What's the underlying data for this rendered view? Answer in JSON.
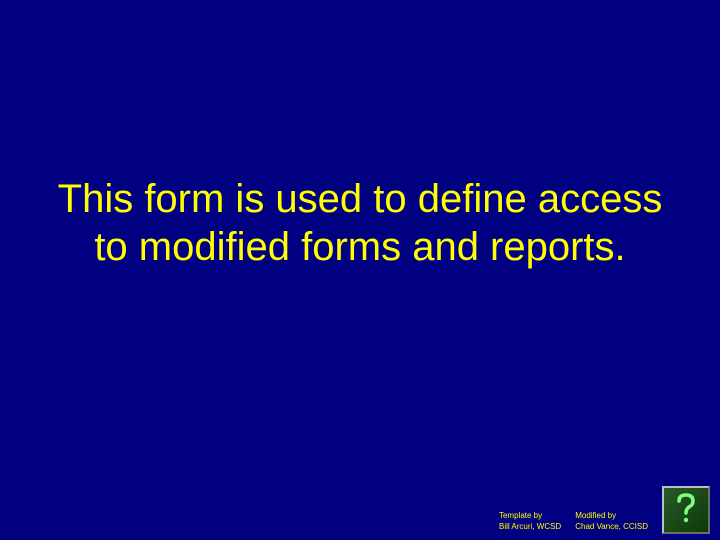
{
  "main": {
    "text": "This form is used to define access to modified forms and reports."
  },
  "credits": {
    "template_label": "Template by",
    "template_author": "Bill Arcuri, WCSD",
    "modified_label": "Modified by",
    "modified_author": "Chad Vance, CCISD"
  },
  "icons": {
    "help": "help-icon"
  }
}
